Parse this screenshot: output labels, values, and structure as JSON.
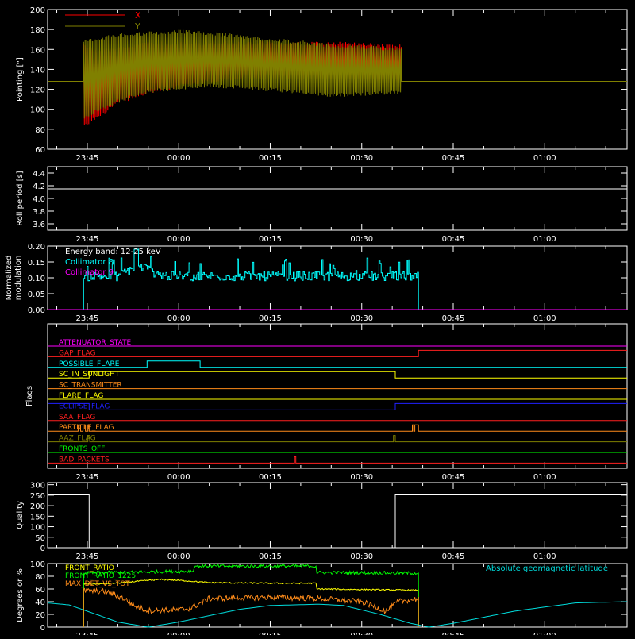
{
  "colors": {
    "background": "#000000",
    "axes": "#ffffff",
    "x_series": "#ff0000",
    "y_series": "#808000",
    "collimator8": "#00ffff",
    "collimator9": "#ff00ff",
    "front_ratio": "#ffff00",
    "front_ratio_1225": "#00ff00",
    "max_det": "#ff8c1a",
    "geomag": "#00dddd"
  },
  "time_axis": {
    "ticks": [
      "23:45",
      "00:00",
      "00:15",
      "00:30",
      "00:45",
      "01:00"
    ],
    "tick_minutes": [
      0,
      15,
      30,
      45,
      60,
      75
    ],
    "range_minutes": [
      -6.5,
      88.5
    ]
  },
  "chart_data": [
    {
      "type": "line",
      "ylabel": "Pointing [\"]",
      "ylim": [
        60,
        200
      ],
      "yticks": [
        "60",
        "80",
        "100",
        "120",
        "140",
        "160",
        "180",
        "200"
      ],
      "legend_position": "top-left",
      "series": [
        {
          "name": "X",
          "color": "#ff0000",
          "t_range_minutes": [
            -0.6,
            51.5
          ],
          "upper": [
            [
              -0.6,
              168
            ],
            [
              1,
              160
            ],
            [
              5,
              163
            ],
            [
              10,
              168
            ],
            [
              20,
              168
            ],
            [
              30,
              168
            ],
            [
              40,
              168
            ],
            [
              51.5,
              165
            ]
          ],
          "lower": [
            [
              -0.6,
              80
            ],
            [
              1,
              88
            ],
            [
              5,
              105
            ],
            [
              10,
              115
            ],
            [
              20,
              127
            ],
            [
              30,
              130
            ],
            [
              40,
              128
            ],
            [
              51.5,
              128
            ]
          ],
          "baseline": 128
        },
        {
          "name": "Y",
          "color": "#808000",
          "t_range_minutes": [
            -0.6,
            51.5
          ],
          "upper": [
            [
              -0.6,
              170
            ],
            [
              1,
              172
            ],
            [
              5,
              176
            ],
            [
              10,
              178
            ],
            [
              15,
              180
            ],
            [
              20,
              178
            ],
            [
              30,
              172
            ],
            [
              40,
              166
            ],
            [
              51.5,
              162
            ]
          ],
          "lower": [
            [
              -0.6,
              90
            ],
            [
              1,
              95
            ],
            [
              5,
              106
            ],
            [
              10,
              116
            ],
            [
              20,
              122
            ],
            [
              30,
              118
            ],
            [
              40,
              112
            ],
            [
              51.5,
              115
            ]
          ],
          "baseline": 128
        }
      ]
    },
    {
      "type": "line",
      "ylabel": "Roll period [s]",
      "ylim": [
        3.5,
        4.5
      ],
      "yticks": [
        "3.6",
        "3.8",
        "4.0",
        "4.2",
        "4.4"
      ],
      "series": [
        {
          "name": "roll",
          "color": "#ffffff",
          "points": [
            [
              -6.5,
              4.15
            ],
            [
              88.5,
              4.15
            ]
          ]
        }
      ]
    },
    {
      "type": "line",
      "ylabel": "Normalized modulation",
      "ylim": [
        0,
        0.2
      ],
      "yticks": [
        "0.00",
        "0.05",
        "0.10",
        "0.15",
        "0.20"
      ],
      "annotation": "Energy band: 12-25 keV",
      "series": [
        {
          "name": "Collimator 8",
          "color": "#00ffff",
          "t_range_minutes": [
            -0.6,
            54.3
          ],
          "base": 0.105,
          "hump": [
            [
              8,
              0.135
            ],
            [
              12,
              0.125
            ]
          ],
          "start_end_zero": true
        },
        {
          "name": "Collimator 9",
          "color": "#ff00ff",
          "points": [
            [
              -6.5,
              0
            ],
            [
              88.5,
              0
            ]
          ]
        }
      ]
    },
    {
      "type": "line",
      "ylabel": "Flags",
      "series": [
        {
          "name": "ATTENUATOR_STATE",
          "color": "#ff00ff",
          "steps": []
        },
        {
          "name": "GAP_FLAG",
          "color": "#ff2020",
          "steps": [
            [
              54.3,
              1
            ]
          ]
        },
        {
          "name": "POSSIBLE_FLARE",
          "color": "#00ffff",
          "steps": [
            [
              9.8,
              1
            ],
            [
              18.5,
              0
            ]
          ]
        },
        {
          "name": "SC_IN_SUNLIGHT",
          "color": "#ffff00",
          "steps": [
            [
              0.3,
              1
            ],
            [
              50.5,
              0
            ]
          ]
        },
        {
          "name": "SC_TRANSMITTER",
          "color": "#ff8c1a",
          "steps": []
        },
        {
          "name": "FLARE_FLAG",
          "color": "#ffff00",
          "steps": []
        },
        {
          "name": "ECLIPSE_FLAG",
          "color": "#2020ff",
          "steps": [
            [
              -6.5,
              1
            ],
            [
              0.3,
              0
            ],
            [
              50.5,
              1
            ]
          ]
        },
        {
          "name": "SAA_FLAG",
          "color": "#ff2020",
          "steps": []
        },
        {
          "name": "PARTICLE_FLAG",
          "color": "#ff8c1a",
          "steps": [
            [
              -1.5,
              1
            ],
            [
              -1.1,
              0
            ],
            [
              -0.7,
              1
            ],
            [
              -0.3,
              0
            ],
            [
              0.1,
              1
            ],
            [
              0.3,
              0
            ],
            [
              53.3,
              1
            ],
            [
              53.5,
              0
            ],
            [
              53.7,
              1
            ],
            [
              54.3,
              0
            ]
          ]
        },
        {
          "name": "AAZ_FLAG",
          "color": "#808000",
          "steps": [
            [
              0.1,
              1
            ],
            [
              0.4,
              0
            ],
            [
              50.2,
              1
            ],
            [
              50.5,
              0
            ]
          ]
        },
        {
          "name": "FRONTS_OFF",
          "color": "#00ff00",
          "steps": []
        },
        {
          "name": "BAD_PACKETS",
          "color": "#ff2020",
          "steps": [
            [
              34.0,
              1
            ],
            [
              34.2,
              0
            ]
          ]
        }
      ]
    },
    {
      "type": "line",
      "ylabel": "Quality",
      "ylim": [
        0,
        310
      ],
      "yticks": [
        "0",
        "50",
        "100",
        "150",
        "200",
        "250",
        "300"
      ],
      "series": [
        {
          "name": "quality",
          "color": "#ffffff",
          "points": [
            [
              -6.5,
              255
            ],
            [
              0.3,
              255
            ],
            [
              0.3,
              0
            ],
            [
              50.5,
              0
            ],
            [
              50.5,
              255
            ],
            [
              88.5,
              255
            ]
          ]
        }
      ]
    },
    {
      "type": "line",
      "ylabel": "Degrees or %",
      "ylim": [
        0,
        100
      ],
      "yticks": [
        "0",
        "20",
        "40",
        "60",
        "80",
        "100"
      ],
      "series": [
        {
          "name": "FRONT_RATIO",
          "color": "#ffff00",
          "t_range_minutes": [
            -0.6,
            54.3
          ],
          "points": [
            [
              -0.6,
              68
            ],
            [
              3,
              68
            ],
            [
              6,
              70
            ],
            [
              8,
              72
            ],
            [
              12,
              75
            ],
            [
              16,
              73
            ],
            [
              20,
              70
            ],
            [
              30,
              69
            ],
            [
              37.5,
              69
            ],
            [
              37.5,
              60
            ],
            [
              54.3,
              58
            ]
          ]
        },
        {
          "name": "FRONT_RATIO_1225",
          "color": "#00ff00",
          "t_range_minutes": [
            -0.6,
            54.3
          ],
          "points": [
            [
              -0.6,
              85
            ],
            [
              10,
              87
            ],
            [
              16,
              88
            ],
            [
              17.5,
              88
            ],
            [
              17.5,
              96
            ],
            [
              37.5,
              96
            ],
            [
              37.5,
              86
            ],
            [
              54.3,
              85
            ]
          ]
        },
        {
          "name": "MAX_DET_VS_TOT",
          "color": "#ff8c1a",
          "t_range_minutes": [
            -0.6,
            54.3
          ],
          "points": [
            [
              -0.6,
              57
            ],
            [
              3,
              56
            ],
            [
              6,
              45
            ],
            [
              8,
              32
            ],
            [
              10,
              26
            ],
            [
              15,
              27
            ],
            [
              17,
              30
            ],
            [
              20,
              45
            ],
            [
              30,
              47
            ],
            [
              38,
              45
            ],
            [
              45,
              40
            ],
            [
              49,
              25
            ],
            [
              51,
              40
            ],
            [
              54.3,
              45
            ]
          ]
        },
        {
          "name": "Absolute geomagnetic latitude",
          "color": "#00dddd",
          "points": [
            [
              -6.5,
              38
            ],
            [
              -3,
              35
            ],
            [
              0,
              25
            ],
            [
              5,
              8
            ],
            [
              10,
              0
            ],
            [
              15,
              8
            ],
            [
              25,
              28
            ],
            [
              30,
              34
            ],
            [
              38,
              36
            ],
            [
              42,
              34
            ],
            [
              48,
              20
            ],
            [
              53,
              6
            ],
            [
              56,
              0
            ],
            [
              60,
              6
            ],
            [
              70,
              25
            ],
            [
              80,
              38
            ],
            [
              88.5,
              40
            ]
          ]
        }
      ]
    }
  ]
}
